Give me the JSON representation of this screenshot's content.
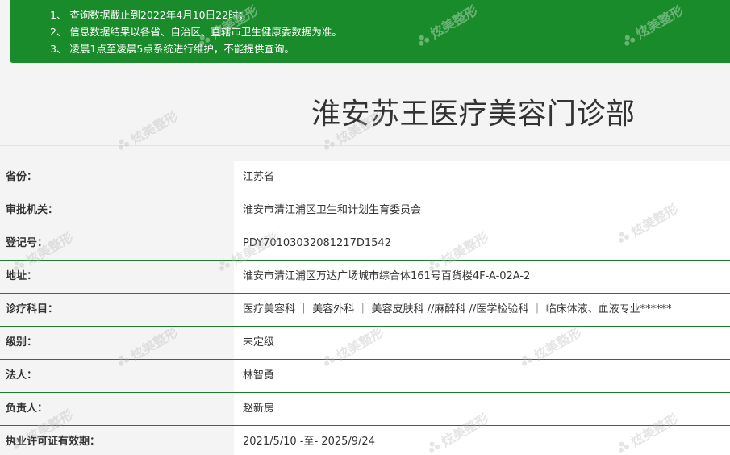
{
  "notice": {
    "lines": [
      "1、 查询数据截止到2022年4月10日22时；",
      "2、 信息数据结果以各省、自治区、直辖市卫生健康委数据为准。",
      "3、 凌晨1点至凌晨5点系统进行维护，不能提供查询。"
    ]
  },
  "title": "淮安苏王医疗美容门诊部",
  "rows": [
    {
      "label": "省份：",
      "value": "江苏省"
    },
    {
      "label": "审批机关：",
      "value": "淮安市清江浦区卫生和计划生育委员会"
    },
    {
      "label": "登记号：",
      "value": "PDY70103032081217D1542"
    },
    {
      "label": "地址：",
      "value": "淮安市清江浦区万达广场城市综合体161号百货楼4F-A-02A-2"
    },
    {
      "label": "诊疗科目：",
      "value": "医疗美容科 ｜ 美容外科 ｜ 美容皮肤科 //麻醉科 //医学检验科 ｜ 临床体液、血液专业******"
    },
    {
      "label": "级别：",
      "value": "未定级"
    },
    {
      "label": "法人：",
      "value": "林智勇"
    },
    {
      "label": "负责人：",
      "value": "赵新房"
    },
    {
      "label": "执业许可证有效期：",
      "value": "2021/5/10 -至- 2025/9/24"
    }
  ],
  "watermark": {
    "text": "炫美整形",
    "icon": "flower-logo-icon"
  },
  "colors": {
    "notice_bg": "#1a8b2a",
    "row_border": "#1b7d32"
  }
}
